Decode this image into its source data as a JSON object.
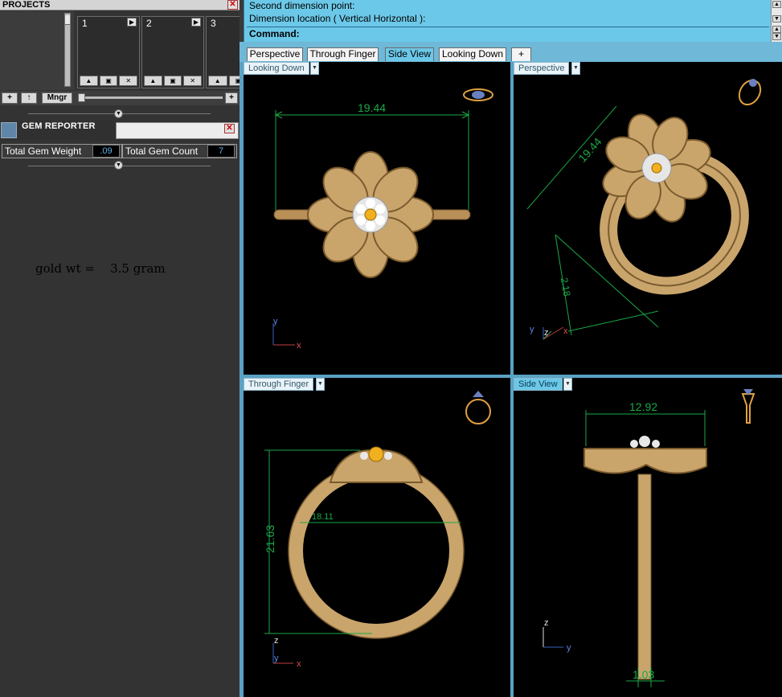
{
  "projects": {
    "title": "PROJECTS",
    "close_icon": "close-icon",
    "slots": [
      {
        "number": "1"
      },
      {
        "number": "2"
      },
      {
        "number": "3"
      }
    ],
    "toolbar": {
      "add_label": "+",
      "up_label": "↑",
      "manager_label": "Mngr",
      "plus_label": "+"
    }
  },
  "gem_reporter": {
    "title": "GEM REPORTER",
    "total_weight_label": "Total Gem Weight",
    "total_weight_value": ".09",
    "total_count_label": "Total Gem Count",
    "total_count_value": "7"
  },
  "note": "gold wt =    3.5 gram",
  "command": {
    "line1": "Second dimension point:",
    "line2": "Dimension location ( Vertical  Horizontal ):",
    "prompt": "Command:"
  },
  "tabs": [
    {
      "label": "Perspective",
      "active": false
    },
    {
      "label": "Through Finger",
      "active": false
    },
    {
      "label": "Side View",
      "active": true
    },
    {
      "label": "Looking Down",
      "active": false
    },
    {
      "label": "+",
      "active": false
    }
  ],
  "viewports": {
    "top_left": {
      "label": "Looking Down",
      "dimension": "19.44"
    },
    "top_right": {
      "label": "Perspective",
      "dimension_a": "19.44",
      "dimension_b": "2.18"
    },
    "bottom_left": {
      "label": "Through Finger",
      "dimension_a": "21.63",
      "dimension_b": "18.11"
    },
    "bottom_right": {
      "label": "Side View",
      "dimension_a": "12.92",
      "dimension_b": "1.03"
    }
  },
  "axes": {
    "x": "x",
    "y": "y",
    "z": "z"
  },
  "colors": {
    "dimension_green": "#1aa846",
    "gold": "#c8a46c",
    "gold_dark": "#8a6a3a",
    "gem_yellow": "#f0b020",
    "accent_blue": "#6cc8e8"
  }
}
